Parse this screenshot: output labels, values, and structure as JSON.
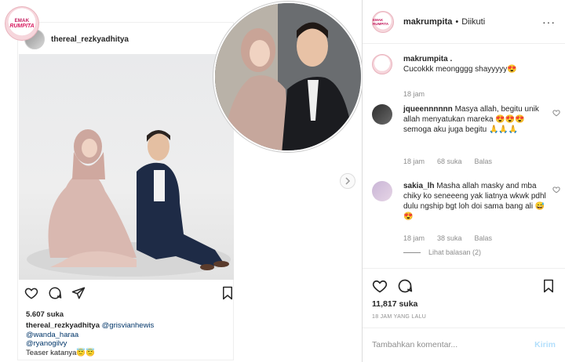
{
  "embedded": {
    "brand_line1": "EMAK",
    "brand_line2": "RUMPITA",
    "username": "thereal_rezkyadhitya",
    "likes": "5.607 suka",
    "caption_user": "thereal_rezkyadhitya",
    "caption_mention1": "@grisvianhewis",
    "caption_mention2": "@wanda_haraa",
    "caption_mention3": "@ryanogilvy",
    "caption_text": "Teaser katanya😇😇"
  },
  "header": {
    "avatar_text": "EMAK RUMPITA",
    "username": "makrumpita",
    "dot": "•",
    "follow_status": "Diikuti",
    "more": "···"
  },
  "comments": [
    {
      "user": "makrumpita .",
      "text": "Cucokkk meongggg shayyyyy😍",
      "time": "18 jam",
      "likes": "",
      "reply": ""
    },
    {
      "user": "jqueennnnnn",
      "text": "Masya allah, begitu unik allah menyatukan mareka 😍😍😍 semoga aku juga begitu 🙏🙏🙏",
      "time": "18 jam",
      "likes": "68 suka",
      "reply": "Balas"
    },
    {
      "user": "sakia_lh",
      "text": "Masha allah masky and mba chiky ko seneeeng yak liatnya wkwk pdhl dulu ngship bgt loh doi sama bang ali 😅😍",
      "time": "18 jam",
      "likes": "38 suka",
      "reply": "Balas",
      "view_replies": "Lihat balasan (2)"
    }
  ],
  "footer": {
    "likes": "11,817 suka",
    "timestamp": "18 JAM YANG LALU",
    "comment_placeholder": "Tambahkan komentar...",
    "post_label": "Kirim"
  },
  "colors": {
    "border": "#dbdbdb",
    "muted": "#8e8e8e",
    "post_disabled": "#b2dffc",
    "mention": "#003569"
  }
}
